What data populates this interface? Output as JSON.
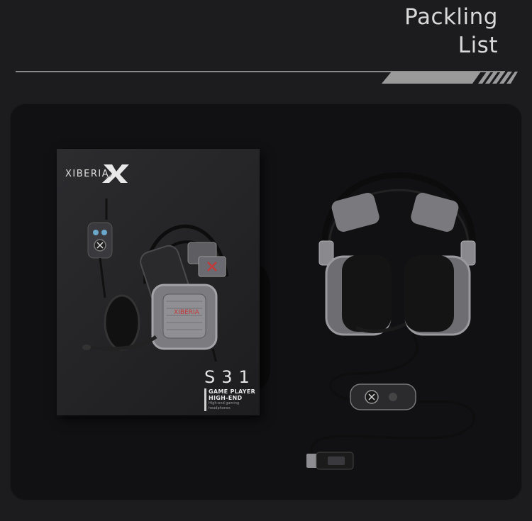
{
  "header": {
    "title_line1": "Packling",
    "title_line2": "List"
  },
  "box": {
    "brand": "XIBERIA",
    "model": "S31",
    "tag_line1": "GAME PLAYER",
    "tag_line2": "HIGH-END",
    "tag_line3": "High-end gaming headphones",
    "headset_logo": "X"
  },
  "colors": {
    "background": "#1c1c1e",
    "panel": "#111113",
    "accent": "#c23a3a"
  }
}
